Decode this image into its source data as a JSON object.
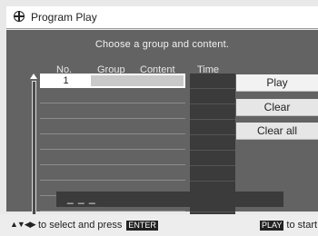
{
  "window": {
    "title": "Program Play"
  },
  "instruction": "Choose a group and content.",
  "columns": {
    "no": "No.",
    "group": "Group",
    "content": "Content",
    "time": "Time"
  },
  "rows": [
    {
      "no": "1"
    },
    {
      "no": ""
    },
    {
      "no": ""
    },
    {
      "no": ""
    },
    {
      "no": ""
    },
    {
      "no": ""
    },
    {
      "no": ""
    },
    {
      "no": ""
    },
    {
      "no": ""
    }
  ],
  "buttons": {
    "play": "Play",
    "clear": "Clear",
    "clear_all": "Clear all"
  },
  "input": {
    "value": "_ _ _"
  },
  "footer": {
    "left_text": "to select and press",
    "left_key": "ENTER",
    "right_key": "PLAY",
    "right_text": "to start"
  },
  "colors": {
    "panel": "#636363",
    "dark_cell": "#3b3b3b",
    "button": "#e6e6e6"
  }
}
